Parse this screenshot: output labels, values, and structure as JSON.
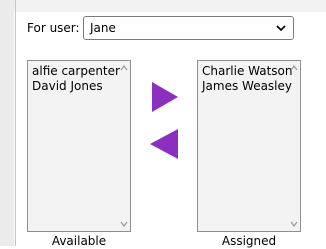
{
  "user_picker": {
    "label": "For user:",
    "selected": "Jane"
  },
  "available": {
    "caption": "Available",
    "items": [
      "alfie carpenter",
      "David Jones"
    ]
  },
  "assigned": {
    "caption": "Assigned",
    "items": [
      "Charlie Watson",
      "James Weasley"
    ]
  },
  "icons": {
    "move_right": "play-right-triangle-icon",
    "move_left": "play-left-triangle-icon",
    "dropdown": "chevron-down-icon"
  },
  "colors": {
    "arrow": "#8a2fc0",
    "list_background": "#f3f3f3",
    "list_border": "#8f8f8f"
  }
}
